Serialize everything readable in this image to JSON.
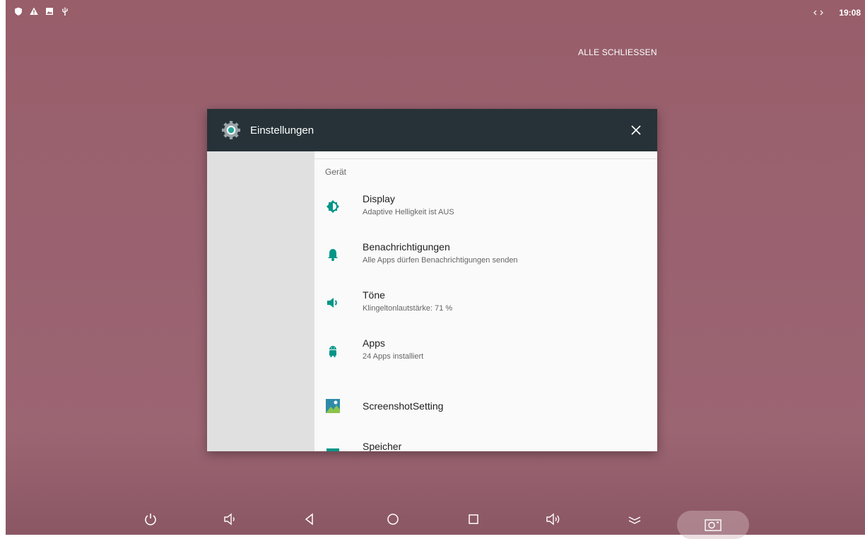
{
  "status_bar": {
    "left_icons": [
      "shield-icon",
      "warning-icon",
      "image-icon",
      "usb-icon"
    ],
    "time": "19:08",
    "sync_icon": "sync-arrows-icon"
  },
  "recents": {
    "close_all_label": "ALLE SCHLIESSEN"
  },
  "card": {
    "app_title": "Einstellungen",
    "app_icon": "settings-gear-icon",
    "close_icon": "close-icon",
    "section_header": "Gerät",
    "items": [
      {
        "title": "Display",
        "subtitle": "Adaptive Helligkeit ist AUS",
        "icon": "brightness-icon"
      },
      {
        "title": "Benachrichtigungen",
        "subtitle": "Alle Apps dürfen Benachrichtigungen senden",
        "icon": "bell-icon"
      },
      {
        "title": "Töne",
        "subtitle": "Klingeltonlautstärke: 71 %",
        "icon": "volume-icon"
      },
      {
        "title": "Apps",
        "subtitle": "24 Apps installiert",
        "icon": "android-icon"
      },
      {
        "title": "ScreenshotSetting",
        "subtitle": "",
        "icon": "screenshot-image-icon"
      },
      {
        "title": "Speicher",
        "subtitle": "",
        "icon": "storage-icon"
      }
    ]
  },
  "colors": {
    "accent": "#009688",
    "header": "#263238",
    "wallpaper": "#9a6270"
  },
  "nav_bar": {
    "buttons": [
      "power-icon",
      "volume-down-icon",
      "back-icon",
      "home-icon",
      "recents-icon",
      "volume-up-icon",
      "collapse-icon",
      "screenshot-icon"
    ]
  }
}
